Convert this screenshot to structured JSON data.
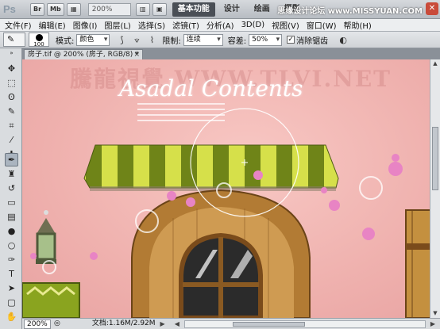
{
  "appbar": {
    "logo": "Ps",
    "buttons": [
      "Br",
      "Mb"
    ],
    "zoom": "200%",
    "workspaces": [
      "基本功能",
      "设计",
      "绘画",
      "摄影"
    ],
    "active_workspace": "基本功能",
    "watermark": "思缘设计论坛 www.MISSYUAN.COM",
    "close_glyph": "✕"
  },
  "menubar": [
    "文件(F)",
    "编辑(E)",
    "图像(I)",
    "图层(L)",
    "选择(S)",
    "滤镜(T)",
    "分析(A)",
    "3D(D)",
    "视图(V)",
    "窗口(W)",
    "帮助(H)"
  ],
  "options": {
    "brush_size": "100",
    "mode_label": "模式:",
    "mode_value": "颜色",
    "limit_label": "限制:",
    "limit_value": "连续",
    "tolerance_label": "容差:",
    "tolerance_value": "50%",
    "antialias_label": "消除锯齿",
    "antialias_checked": "✓"
  },
  "document": {
    "tab_title": "房子.tif @ 200% (房子, RGB/8) *",
    "tab_close": "×",
    "canvas_watermark": "騰龍視覺 WWW.TLVI.NET",
    "canvas_title": "Asadal Contents"
  },
  "status": {
    "zoom": "200%",
    "info": "文档:1.16M/2.92M"
  },
  "tools": [
    {
      "name": "move-tool-icon",
      "glyph": "✥"
    },
    {
      "name": "marquee-tool-icon",
      "glyph": "⬚"
    },
    {
      "name": "lasso-tool-icon",
      "glyph": "ʘ"
    },
    {
      "name": "quick-select-tool-icon",
      "glyph": "✎"
    },
    {
      "name": "crop-tool-icon",
      "glyph": "⌗"
    },
    {
      "name": "eyedropper-tool-icon",
      "glyph": "⁄"
    },
    {
      "name": "healing-brush-tool-icon",
      "glyph": "✚"
    },
    {
      "name": "brush-tool-icon",
      "glyph": "✒"
    },
    {
      "name": "clone-stamp-tool-icon",
      "glyph": "♜"
    },
    {
      "name": "history-brush-tool-icon",
      "glyph": "↺"
    },
    {
      "name": "eraser-tool-icon",
      "glyph": "▭"
    },
    {
      "name": "gradient-tool-icon",
      "glyph": "▤"
    },
    {
      "name": "blur-tool-icon",
      "glyph": "●"
    },
    {
      "name": "dodge-tool-icon",
      "glyph": "○"
    },
    {
      "name": "pen-tool-icon",
      "glyph": "✑"
    },
    {
      "name": "type-tool-icon",
      "glyph": "T"
    },
    {
      "name": "path-select-tool-icon",
      "glyph": "➤"
    },
    {
      "name": "shape-tool-icon",
      "glyph": "▢"
    },
    {
      "name": "hand-tool-icon",
      "glyph": "✋"
    },
    {
      "name": "zoom-tool-icon",
      "glyph": "⚲"
    }
  ],
  "colors": {
    "canvas_pink": "#f2b7b4",
    "awning_green": "#7a8f1c",
    "awning_yellow": "#d8e24a",
    "wood": "#b07a33",
    "active_workspace_bg": "#4a4f56"
  }
}
